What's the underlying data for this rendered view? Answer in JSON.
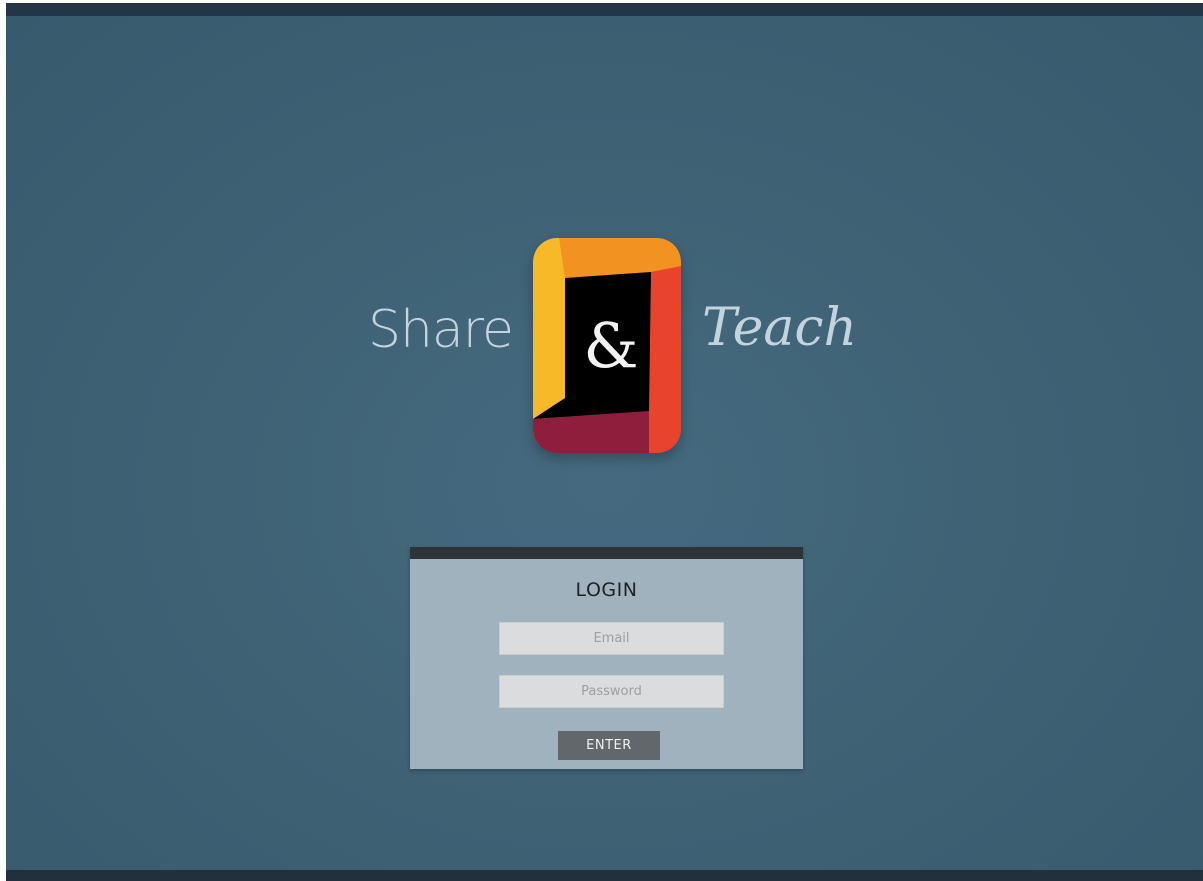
{
  "brand": {
    "word_left": "Share",
    "ampersand": "&",
    "word_right": "Teach",
    "colors": {
      "yellow": "#f7b928",
      "orange": "#f29220",
      "red": "#e8442d",
      "maroon": "#8f1d3c",
      "black": "#000000"
    }
  },
  "login": {
    "title": "LOGIN",
    "email_placeholder": "Email",
    "password_placeholder": "Password",
    "enter_label": "ENTER"
  },
  "theme": {
    "background": "#3f6275",
    "card": "#a1b2bf",
    "card_header": "#2e3338",
    "button": "#62676b"
  }
}
